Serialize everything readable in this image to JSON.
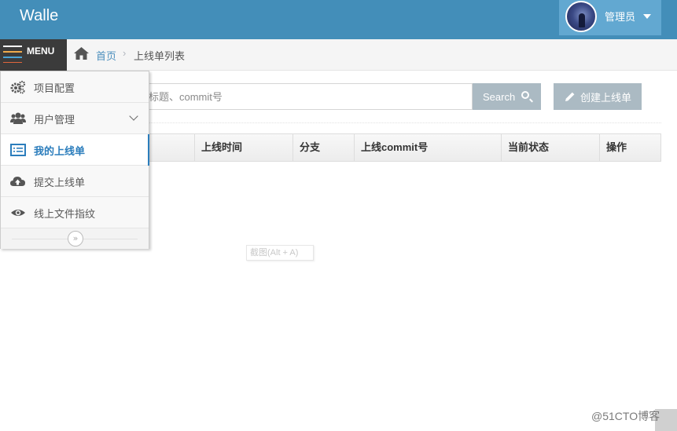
{
  "app": {
    "brand": "Walle"
  },
  "user": {
    "name": "管理员"
  },
  "menu_toggle": {
    "label": "MENU"
  },
  "breadcrumb": {
    "home": "首页",
    "separator": "›",
    "current": "上线单列表"
  },
  "search": {
    "placeholder": "标题、commit号",
    "value": "",
    "button_label": "Search"
  },
  "create_button": {
    "label": "创建上线单"
  },
  "table": {
    "headers": [
      "上线时间",
      "分支",
      "上线commit号",
      "当前状态",
      "操作"
    ]
  },
  "sidebar": {
    "items": [
      {
        "label": "项目配置",
        "icon": "gears-icon",
        "active": false
      },
      {
        "label": "用户管理",
        "icon": "users-icon",
        "active": false,
        "expandable": true
      },
      {
        "label": "我的上线单",
        "icon": "list-icon",
        "active": true
      },
      {
        "label": "提交上线单",
        "icon": "cloud-upload-icon",
        "active": false
      },
      {
        "label": "线上文件指纹",
        "icon": "eye-icon",
        "active": false
      }
    ],
    "collapse_symbol": "»"
  },
  "tooltip": {
    "text": "截图(Alt + A)"
  },
  "watermark": {
    "text": "@51CTO博客"
  },
  "colors": {
    "navbar": "#438eb9",
    "user_box": "#62a8d1",
    "menu_toggle": "#3b3b3b",
    "button": "#abbac3",
    "link": "#4c8fbd",
    "active_item": "#2b7dbc"
  }
}
